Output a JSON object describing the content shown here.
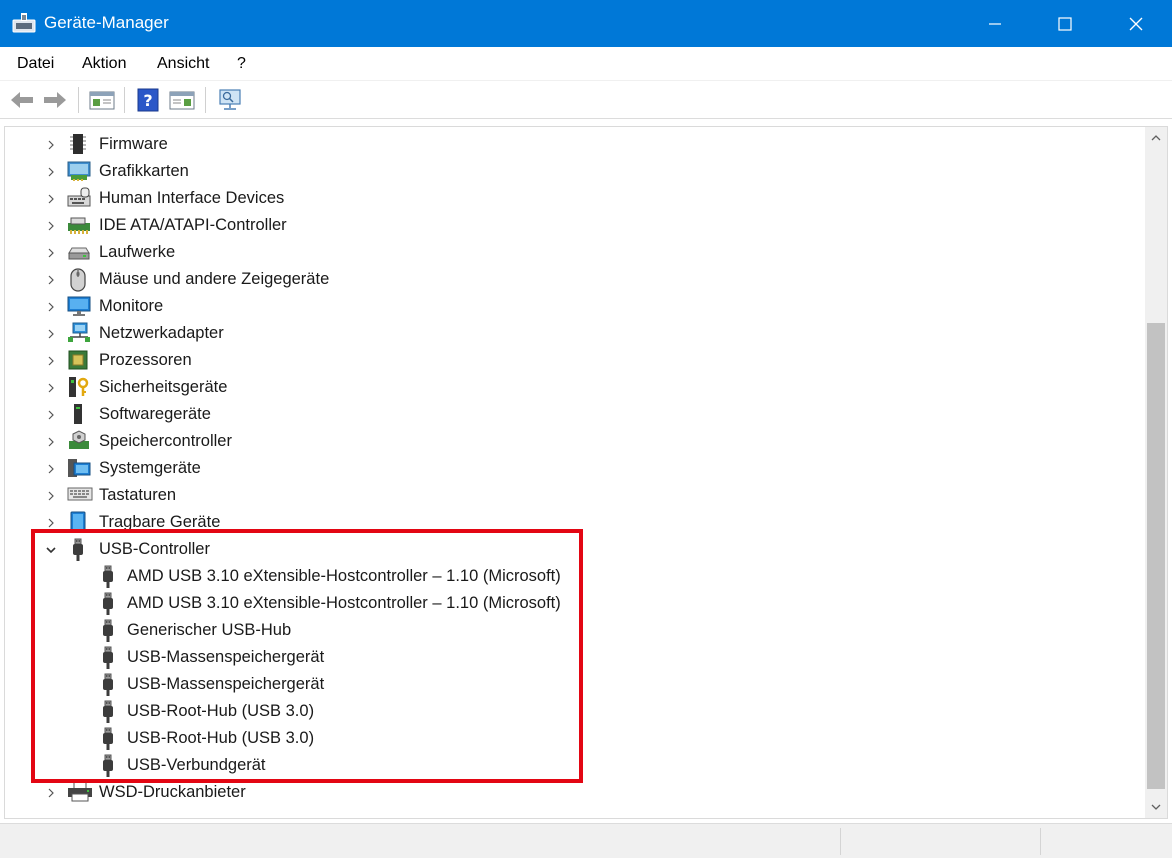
{
  "window": {
    "title": "Geräte-Manager"
  },
  "menu": [
    "Datei",
    "Aktion",
    "Ansicht",
    "?"
  ],
  "toolbar": {
    "buttons": [
      "back-arrow-icon",
      "forward-arrow-icon",
      "properties-icon",
      "help-icon",
      "view-icon",
      "scan-hardware-icon"
    ]
  },
  "tree": {
    "categories": [
      {
        "label": "Firmware",
        "icon": "firmware-chip-icon",
        "expanded": false
      },
      {
        "label": "Grafikkarten",
        "icon": "display-adapter-icon",
        "expanded": false
      },
      {
        "label": "Human Interface Devices",
        "icon": "hid-icon",
        "expanded": false
      },
      {
        "label": "IDE ATA/ATAPI-Controller",
        "icon": "ide-controller-icon",
        "expanded": false
      },
      {
        "label": "Laufwerke",
        "icon": "disk-drive-icon",
        "expanded": false
      },
      {
        "label": "Mäuse und andere Zeigegeräte",
        "icon": "mouse-icon",
        "expanded": false
      },
      {
        "label": "Monitore",
        "icon": "monitor-icon",
        "expanded": false
      },
      {
        "label": "Netzwerkadapter",
        "icon": "network-adapter-icon",
        "expanded": false
      },
      {
        "label": "Prozessoren",
        "icon": "processor-icon",
        "expanded": false
      },
      {
        "label": "Sicherheitsgeräte",
        "icon": "security-key-icon",
        "expanded": false
      },
      {
        "label": "Softwaregeräte",
        "icon": "software-device-icon",
        "expanded": false
      },
      {
        "label": "Speichercontroller",
        "icon": "storage-controller-icon",
        "expanded": false
      },
      {
        "label": "Systemgeräte",
        "icon": "system-device-icon",
        "expanded": false
      },
      {
        "label": "Tastaturen",
        "icon": "keyboard-icon",
        "expanded": false
      },
      {
        "label": "Tragbare Geräte",
        "icon": "portable-device-icon",
        "expanded": false
      },
      {
        "label": "USB-Controller",
        "icon": "usb-plug-icon",
        "expanded": true,
        "children": [
          "AMD USB 3.10 eXtensible-Hostcontroller – 1.10 (Microsoft)",
          "AMD USB 3.10 eXtensible-Hostcontroller – 1.10 (Microsoft)",
          "Generischer USB-Hub",
          "USB-Massenspeichergerät",
          "USB-Massenspeichergerät",
          "USB-Root-Hub (USB 3.0)",
          "USB-Root-Hub (USB 3.0)",
          "USB-Verbundgerät"
        ]
      },
      {
        "label": "WSD-Druckanbieter",
        "icon": "printer-icon",
        "expanded": false
      }
    ]
  },
  "colors": {
    "titlebar": "#0078d7",
    "highlight": "#e30613"
  }
}
